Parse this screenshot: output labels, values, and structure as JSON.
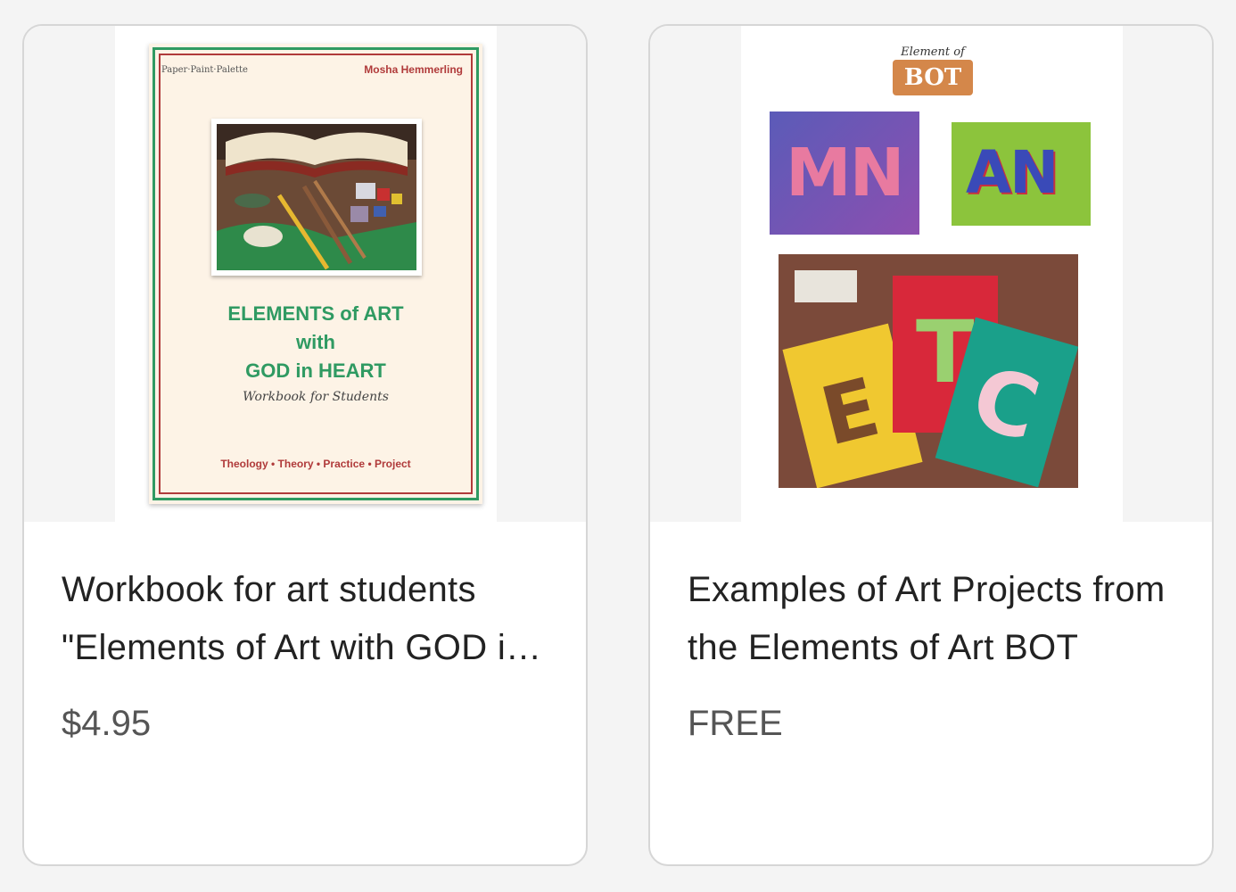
{
  "products": [
    {
      "title": "Workbook for art students \"Elements of Art with GOD in HEART\"",
      "price": "$4.95",
      "cover": {
        "publisher": "Paper·Paint·Palette",
        "author": "Mosha Hemmerling",
        "title_line1": "ELEMENTS of ART",
        "title_line2": "with",
        "title_line3": "GOD in HEART",
        "subtitle": "Workbook for Students",
        "bottom_line": "Theology • Theory • Practice • Project"
      }
    },
    {
      "title": "Examples of Art Projects from the Elements of Art BOT",
      "price": "FREE",
      "cover": {
        "header": "Element of Art",
        "logo": "BOT",
        "panel1_letters": "MN",
        "panel2_letters": "AN",
        "panel3_letters": [
          "E",
          "T",
          "C"
        ]
      }
    }
  ]
}
